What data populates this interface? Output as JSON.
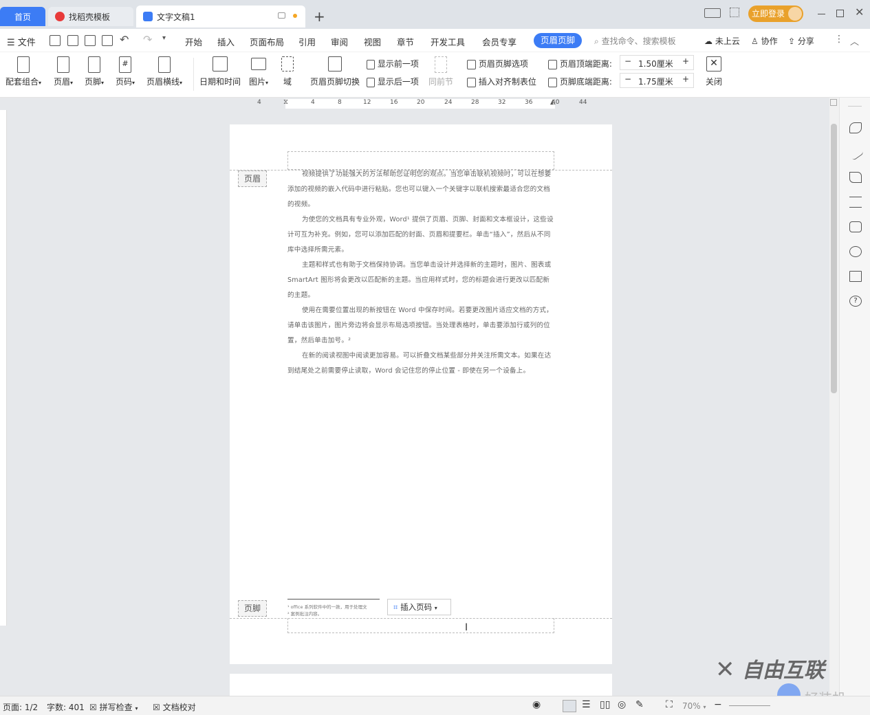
{
  "tabs": {
    "home": "首页",
    "template": "找稻壳模板",
    "doc": "文字文稿1",
    "login": "立即登录"
  },
  "menu": {
    "file": "文件",
    "items": [
      "开始",
      "插入",
      "页面布局",
      "引用",
      "审阅",
      "视图",
      "章节",
      "开发工具",
      "会员专享"
    ],
    "active": "页眉页脚",
    "search": "查找命令、搜索模板",
    "cloud": "未上云",
    "collab": "协作",
    "share": "分享"
  },
  "toolbar": {
    "combo": "配套组合",
    "header": "页眉",
    "footer": "页脚",
    "pagenum": "页码",
    "hline": "页眉横线",
    "datetime": "日期和时间",
    "picture": "图片",
    "field": "域",
    "switch": "页眉页脚切换",
    "prev": "显示前一项",
    "next": "显示后一项",
    "same": "同前节",
    "options": "页眉页脚选项",
    "align": "插入对齐制表位",
    "top_label": "页眉顶端距离:",
    "top_val": "1.50厘米",
    "bottom_label": "页脚底端距离:",
    "bottom_val": "1.75厘米",
    "close": "关闭"
  },
  "ruler": [
    "4",
    "4",
    "8",
    "12",
    "16",
    "20",
    "24",
    "28",
    "32",
    "36",
    "40",
    "44"
  ],
  "doc": {
    "header_label": "页眉",
    "footer_label": "页脚",
    "p1": "视频提供了功能强大的方法帮助您证明您的观点。当您单击联机视频时，可以在想要添加的视频的嵌入代码中进行粘贴。您也可以键入一个关键字以联机搜索最适合您的文档的视频。",
    "p2": "为使您的文档具有专业外观，Word¹ 提供了页眉、页脚、封面和文本框设计，这些设计可互为补充。例如，您可以添加匹配的封面、页眉和提要栏。单击“插入”，然后从不同库中选择所需元素。",
    "p3": "主题和样式也有助于文档保持协调。当您单击设计并选择新的主题时，图片、图表或 SmartArt 图形将会更改以匹配新的主题。当应用样式时，您的标题会进行更改以匹配新的主题。",
    "p4": "使用在需要位置出现的新按钮在 Word 中保存时间。若要更改图片适应文档的方式，请单击该图片，图片旁边将会显示布局选项按钮。当处理表格时，单击要添加行或列的位置，然后单击加号。²",
    "p5": "在新的阅读视图中阅读更加容易。可以折叠文档某些部分并关注所需文本。如果在达到结尾处之前需要停止读取，Word 会记住您的停止位置 - 即使在另一个设备上。",
    "fn1": "¹ office 系列软件中的一款，用于处理文",
    "fn2": "² 案例批注内容。",
    "insert_pagenum": "插入页码"
  },
  "status": {
    "page": "页面: 1/2",
    "words": "字数: 401",
    "spell": "拼写检查",
    "proof": "文档校对",
    "zoom": "70%"
  },
  "watermark": {
    "brand": "自由互联",
    "site": "好装机"
  }
}
